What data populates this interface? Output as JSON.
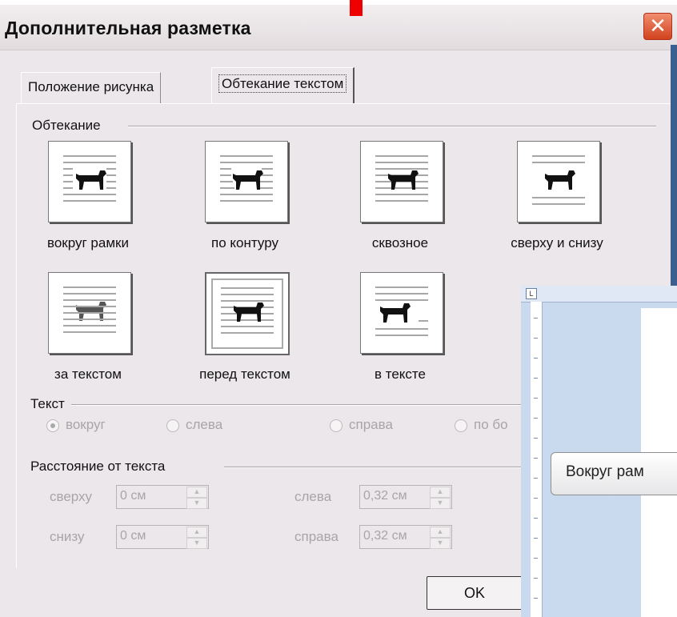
{
  "window": {
    "title": "Дополнительная разметка",
    "close_glyph": "✕"
  },
  "tabs": [
    {
      "label": "Положение рисунка",
      "active": false
    },
    {
      "label": "Обтекание текстом",
      "active": true
    }
  ],
  "wrapping": {
    "group_label": "Обтекание",
    "options": [
      {
        "label": "вокруг рамки",
        "icon": "square-wrap-icon"
      },
      {
        "label": "по контуру",
        "icon": "tight-wrap-icon"
      },
      {
        "label": "сквозное",
        "icon": "through-wrap-icon"
      },
      {
        "label": "сверху и снизу",
        "icon": "top-bottom-wrap-icon"
      },
      {
        "label": "за текстом",
        "icon": "behind-text-icon"
      },
      {
        "label": "перед текстом",
        "icon": "in-front-of-text-icon",
        "selected": true
      },
      {
        "label": "в тексте",
        "icon": "inline-text-icon"
      }
    ]
  },
  "text_side": {
    "group_label": "Текст",
    "options": [
      {
        "label": "вокруг",
        "checked": true
      },
      {
        "label": "слева",
        "checked": false
      },
      {
        "label": "справа",
        "checked": false
      },
      {
        "label": "по бо",
        "checked": false
      }
    ]
  },
  "distance": {
    "group_label": "Расстояние от текста",
    "top_label": "сверху",
    "top_value": "0 см",
    "bottom_label": "снизу",
    "bottom_value": "0 см",
    "left_label": "слева",
    "left_value": "0,32 см",
    "right_label": "справа",
    "right_value": "0,32 см"
  },
  "buttons": {
    "ok": "OK"
  },
  "overlay": {
    "ruler_corner": "L",
    "tooltip": "Вокруг рам"
  },
  "colors": {
    "close_button": "#d2421d",
    "dialog_bg": "#ece7ea",
    "overlay_bg": "#c9d9ee"
  }
}
